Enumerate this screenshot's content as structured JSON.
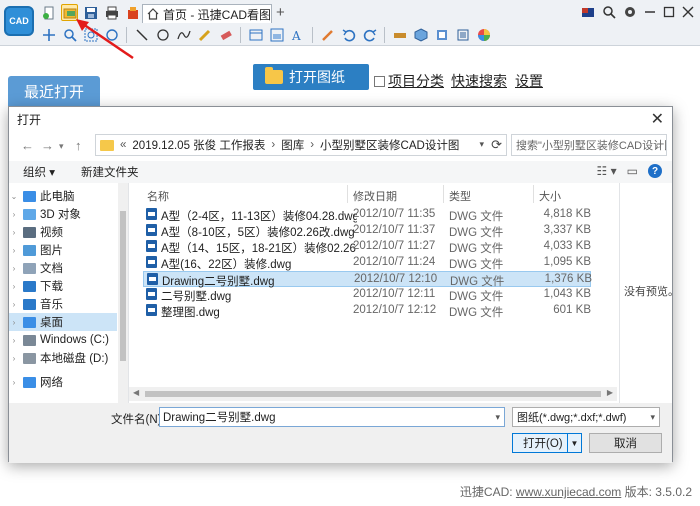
{
  "app": {
    "logo_text": "CAD",
    "tab_title": "首页 - 迅捷CAD看图",
    "tab_add": "+"
  },
  "main": {
    "recent_tab": "最近打开",
    "open_drawing_button": "打开图纸",
    "project_category_label": "项目分类",
    "quick_search_link": "快速搜索",
    "settings_link": "设置"
  },
  "footer": {
    "prefix": "迅捷CAD: ",
    "url": "www.xunjiecad.com",
    "version": " 版本: 3.5.0.2"
  },
  "dialog": {
    "title": "打开",
    "close": "✕",
    "path": [
      "«",
      "2019.12.05 张俊 工作报表",
      "›",
      "图库",
      "›",
      "小型别墅区装修CAD设计图"
    ],
    "search_placeholder": "搜索\"小型别墅区装修CAD设计图\"",
    "organize_label": "组织 ▾",
    "new_folder_label": "新建文件夹",
    "preview_text": "没有预览。",
    "nav_items": [
      {
        "label": "此电脑",
        "icon": "computer-icon",
        "color": "#3a8ee6"
      },
      {
        "label": "3D 对象",
        "icon": "cube-icon",
        "color": "#5fa8e8"
      },
      {
        "label": "视频",
        "icon": "video-icon",
        "color": "#5a6d80"
      },
      {
        "label": "图片",
        "icon": "picture-icon",
        "color": "#4f9ad8"
      },
      {
        "label": "文档",
        "icon": "document-icon",
        "color": "#8fa3b8"
      },
      {
        "label": "下载",
        "icon": "download-icon",
        "color": "#2a79c9"
      },
      {
        "label": "音乐",
        "icon": "music-icon",
        "color": "#2a79c9"
      },
      {
        "label": "桌面",
        "icon": "desktop-icon",
        "color": "#3a8ee6"
      },
      {
        "label": "Windows (C:)",
        "icon": "drive-c-icon",
        "color": "#7a8896"
      },
      {
        "label": "本地磁盘 (D:)",
        "icon": "drive-d-icon",
        "color": "#8a96a2"
      },
      {
        "label": "网络",
        "icon": "network-icon",
        "color": "#3a8ee6"
      }
    ],
    "columns": {
      "name": "名称",
      "date": "修改日期",
      "type": "类型",
      "size": "大小"
    },
    "files": [
      {
        "name": "A型（2-4区，11-13区）装修04.28.dwg",
        "date": "2012/10/7 11:35",
        "type": "DWG 文件",
        "size": "4,818 KB"
      },
      {
        "name": "A型（8-10区，5区）装修02.26改.dwg",
        "date": "2012/10/7 11:37",
        "type": "DWG 文件",
        "size": "3,337 KB"
      },
      {
        "name": "A型（14、15区，18-21区）装修02.26...",
        "date": "2012/10/7 11:27",
        "type": "DWG 文件",
        "size": "4,033 KB"
      },
      {
        "name": "A型(16、22区）装修.dwg",
        "date": "2012/10/7 11:24",
        "type": "DWG 文件",
        "size": "1,095 KB"
      },
      {
        "name": "Drawing二号别墅.dwg",
        "date": "2012/10/7 12:10",
        "type": "DWG 文件",
        "size": "1,376 KB"
      },
      {
        "name": "二号别墅.dwg",
        "date": "2012/10/7 12:11",
        "type": "DWG 文件",
        "size": "1,043 KB"
      },
      {
        "name": "整理图.dwg",
        "date": "2012/10/7 12:12",
        "type": "DWG 文件",
        "size": "601 KB"
      }
    ],
    "filename_label": "文件名(N):",
    "filename_value": "Drawing二号别墅.dwg",
    "filter_value": "图纸(*.dwg;*.dxf;*.dwf)",
    "open_button": "打开(O)",
    "cancel_button": "取消"
  }
}
